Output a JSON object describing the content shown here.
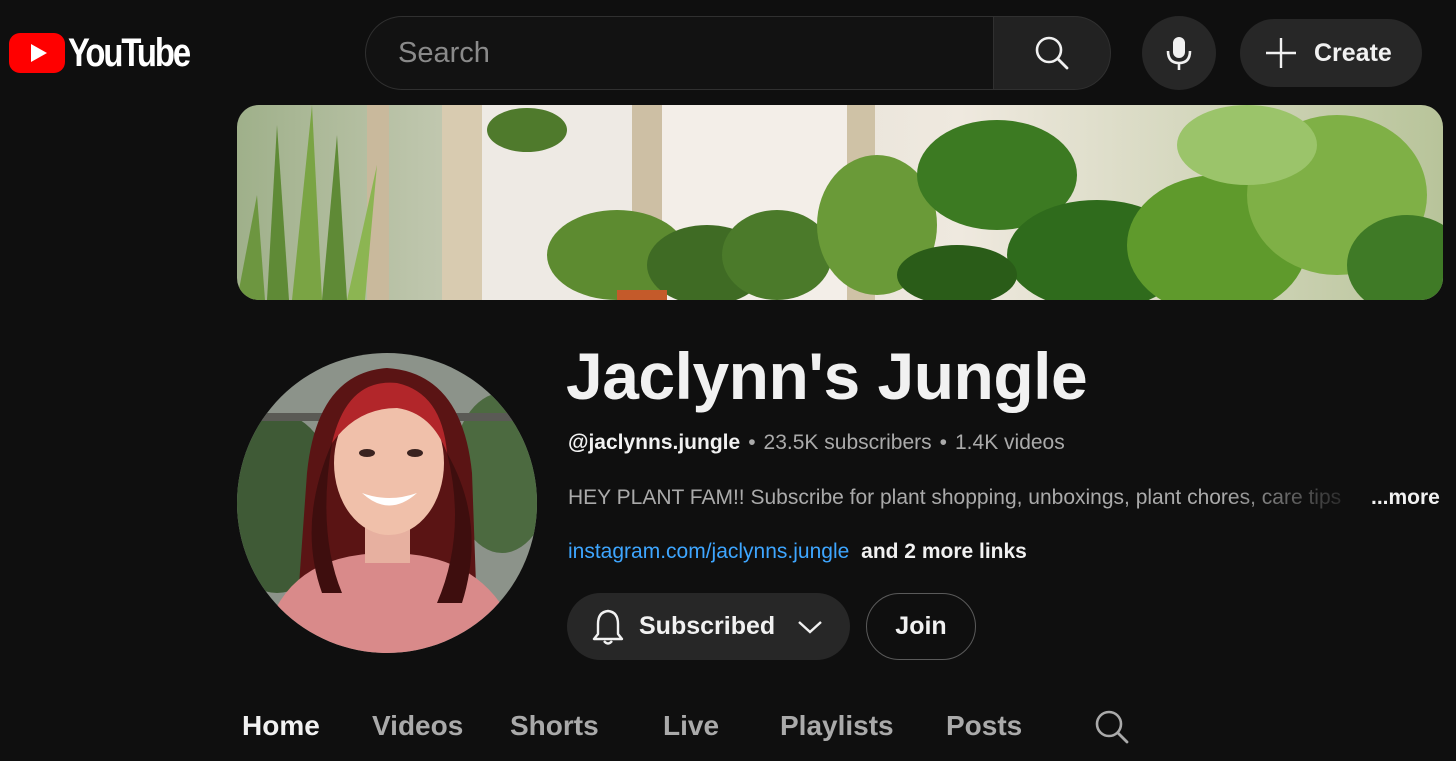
{
  "header": {
    "logo_text": "YouTube",
    "search_placeholder": "Search",
    "create_label": "Create",
    "brand_red": "#ff0000"
  },
  "channel": {
    "name": "Jaclynn's Jungle",
    "handle": "@jaclynns.jungle",
    "separator": "•",
    "subscribers": "23.5K subscribers",
    "videos": "1.4K videos",
    "description": "HEY PLANT FAM!! Subscribe for plant shopping, unboxings, plant chores, care tips",
    "more_label": "...more",
    "link_text": "instagram.com/jaclynns.jungle",
    "more_links_text": "and 2 more links",
    "link_color": "#3ea6ff"
  },
  "actions": {
    "subscribed_label": "Subscribed",
    "join_label": "Join"
  },
  "tabs": [
    {
      "label": "Home",
      "active": true
    },
    {
      "label": "Videos",
      "active": false
    },
    {
      "label": "Shorts",
      "active": false
    },
    {
      "label": "Live",
      "active": false
    },
    {
      "label": "Playlists",
      "active": false
    },
    {
      "label": "Posts",
      "active": false
    }
  ],
  "icons": {
    "logo": "youtube-play-icon",
    "search": "search-icon",
    "mic": "microphone-icon",
    "create": "plus-icon",
    "bell": "bell-icon",
    "chevron": "chevron-down-icon",
    "tab_search": "search-icon"
  }
}
